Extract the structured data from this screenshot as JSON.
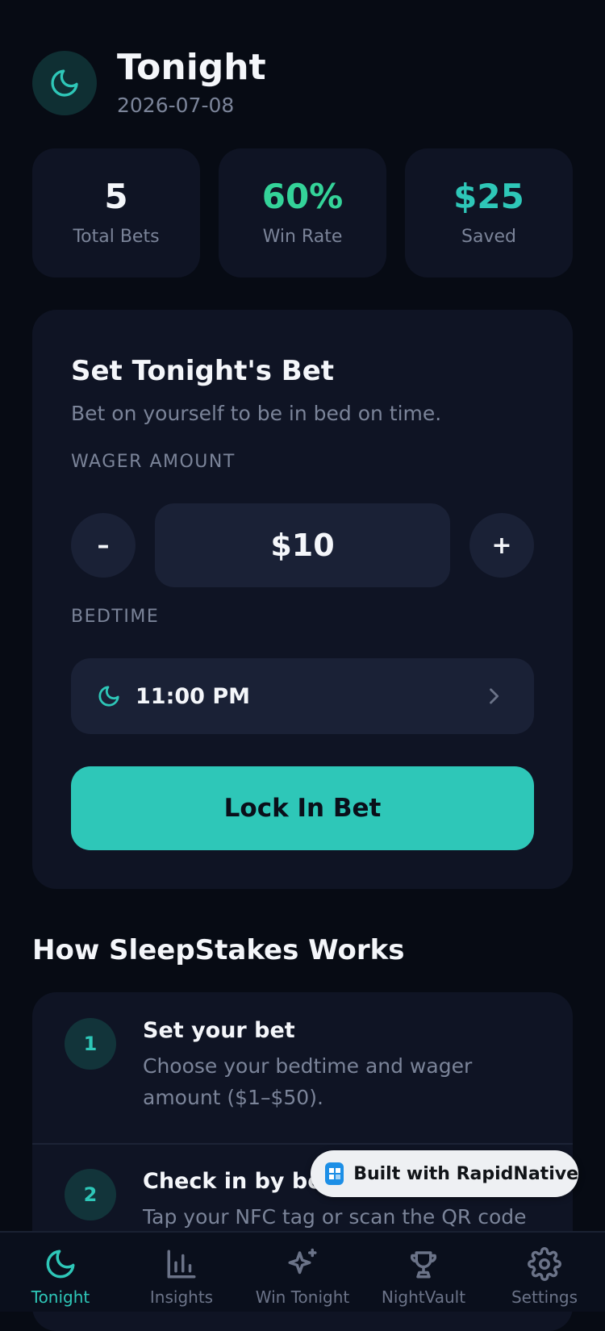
{
  "colors": {
    "accent": "#2ec7b8",
    "win_green": "#34d399",
    "background": "#070b14",
    "card": "#0f1424"
  },
  "header": {
    "title": "Tonight",
    "date": "2026-07-08",
    "icon": "moon-icon"
  },
  "stats": [
    {
      "value": "5",
      "label": "Total Bets"
    },
    {
      "value": "60%",
      "label": "Win Rate"
    },
    {
      "value": "$25",
      "label": "Saved"
    }
  ],
  "bet_card": {
    "title": "Set Tonight's Bet",
    "subtitle": "Bet on yourself to be in bed on time.",
    "wager_label": "WAGER AMOUNT",
    "wager_value": "$10",
    "decrement_label": "–",
    "increment_label": "+",
    "bedtime_label": "BEDTIME",
    "bedtime_value": "11:00 PM",
    "lock_button": "Lock In Bet"
  },
  "how_it_works": {
    "title": "How SleepStakes Works",
    "steps": [
      {
        "number": "1",
        "title": "Set your bet",
        "description": "Choose your bedtime and wager amount ($1–$50)."
      },
      {
        "number": "2",
        "title": "Check in by bedtime",
        "description": "Tap your NFC tag or scan the QR code"
      }
    ]
  },
  "badge": {
    "text": "Built with RapidNative"
  },
  "tabs": [
    {
      "label": "Tonight",
      "icon": "moon-icon",
      "active": true
    },
    {
      "label": "Insights",
      "icon": "bar-chart-icon",
      "active": false
    },
    {
      "label": "Win Tonight",
      "icon": "sparkles-icon",
      "active": false
    },
    {
      "label": "NightVault",
      "icon": "trophy-icon",
      "active": false
    },
    {
      "label": "Settings",
      "icon": "gear-icon",
      "active": false
    }
  ]
}
